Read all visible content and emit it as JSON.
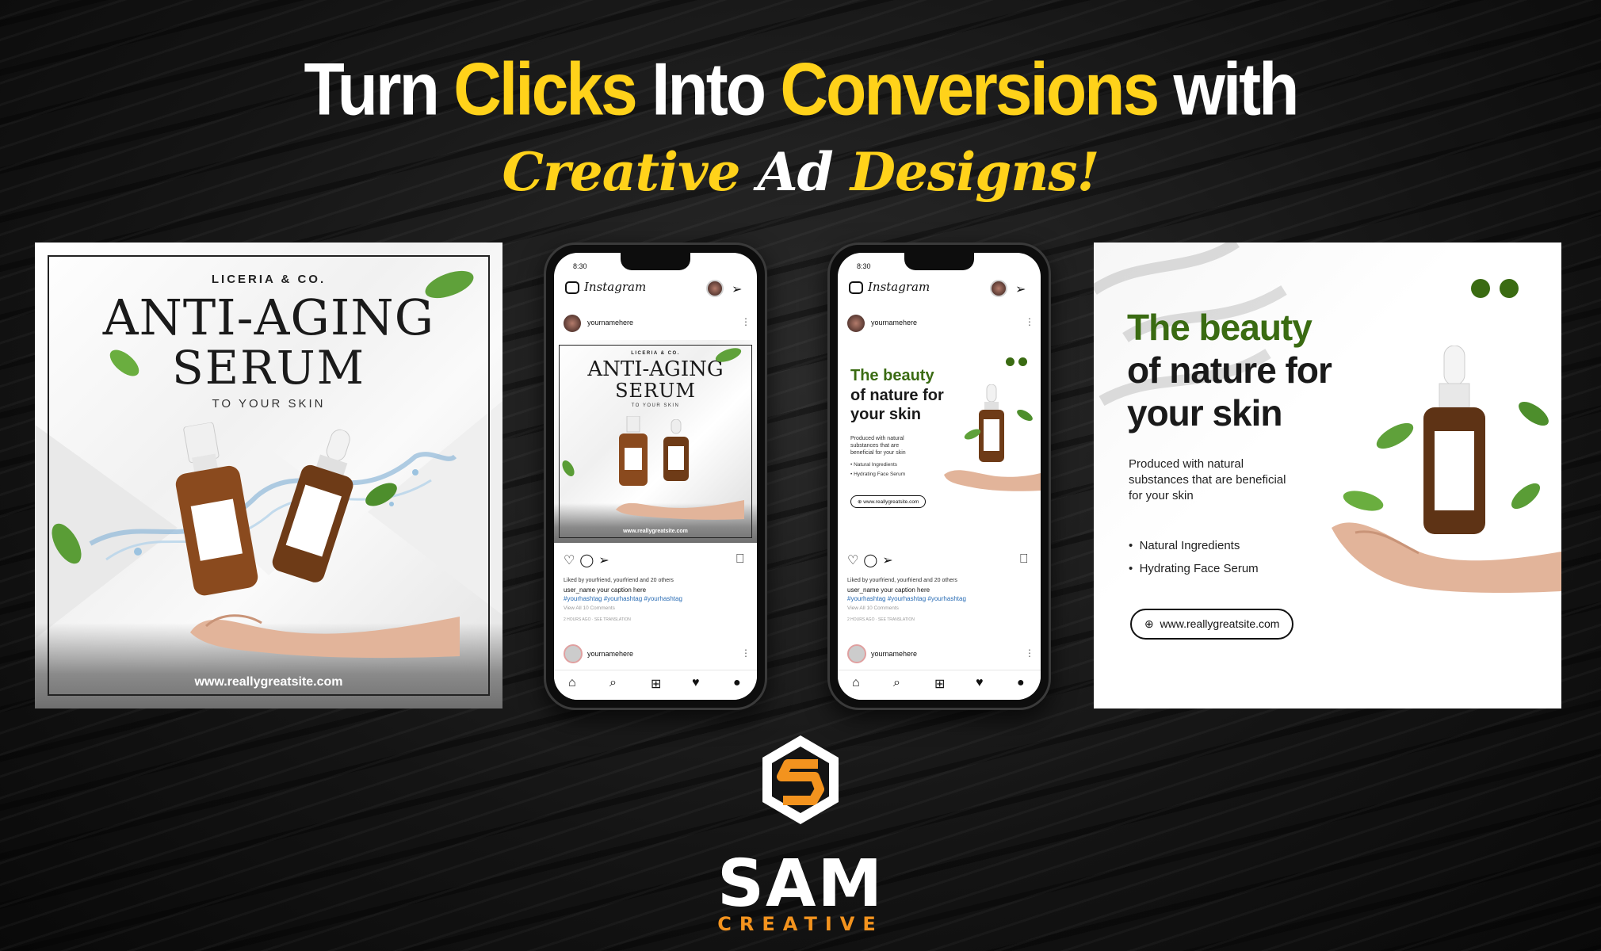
{
  "headline": {
    "line1": [
      {
        "text": "Turn ",
        "highlight": false
      },
      {
        "text": "Clicks",
        "highlight": true
      },
      {
        "text": " Into ",
        "highlight": false
      },
      {
        "text": "Conversions",
        "highlight": true
      },
      {
        "text": " with",
        "highlight": false
      }
    ],
    "line2": [
      {
        "text": "Creative ",
        "highlight": true
      },
      {
        "text": "Ad ",
        "highlight": false
      },
      {
        "text": "Designs!",
        "highlight": true
      }
    ],
    "accent_color": "#ffd21a"
  },
  "card_left": {
    "brand": "LICERIA & CO.",
    "title_line1": "ANTI-AGING",
    "title_line2": "SERUM",
    "subtitle": "TO YOUR SKIN",
    "url": "www.reallygreatsite.com"
  },
  "phone_left": {
    "time": "8:30",
    "app_name": "Instagram",
    "username": "yournamehere",
    "liked_by": "Liked by yourfriend, yourfriend and 20 others",
    "caption": "user_name  your caption here",
    "hashtags": "#yourhashtag #yourhashtag #yourhashtag",
    "comments": "View All 10 Comments",
    "meta": "2 HOURS AGO  ·  SEE TRANSLATION",
    "next_username": "yournamehere",
    "post": {
      "brand": "LICERIA & CO.",
      "title_line1": "ANTI-AGING",
      "title_line2": "SERUM",
      "subtitle": "TO YOUR SKIN",
      "url": "www.reallygreatsite.com"
    }
  },
  "phone_right": {
    "time": "8:30",
    "app_name": "Instagram",
    "username": "yournamehere",
    "liked_by": "Liked by yourfriend, yourfriend and 20 others",
    "caption": "user_name  your caption here",
    "hashtags": "#yourhashtag #yourhashtag #yourhashtag",
    "comments": "View All 10 Comments",
    "meta": "2 HOURS AGO  ·  SEE TRANSLATION",
    "next_username": "yournamehere",
    "post": {
      "title_line1": "The beauty",
      "title_line2": "of nature for your skin",
      "description": "Produced with natural substances that are beneficial for your skin",
      "list": [
        "Natural Ingredients",
        "Hydrating Face Serum"
      ],
      "url": "www.reallygreatsite.com"
    }
  },
  "card_right": {
    "title_line1": "The beauty",
    "title_line2": "of nature for your skin",
    "description": "Produced with natural substances that are beneficial for your skin",
    "list_item_1": "Natural Ingredients",
    "list_item_2": "Hydrating Face Serum",
    "url": "www.reallygreatsite.com",
    "green": "#3a6b12"
  },
  "logo": {
    "name": "SAM",
    "sub": "CREATIVE",
    "orange": "#f3931e"
  },
  "icons": [
    "camera-icon",
    "send-icon",
    "heart-icon",
    "comment-icon",
    "share-icon",
    "bookmark-icon",
    "home-icon",
    "search-icon",
    "add-icon",
    "profile-icon",
    "globe-icon",
    "leaf-icon",
    "serum-bottle",
    "dropper-bottle",
    "hand-image"
  ]
}
